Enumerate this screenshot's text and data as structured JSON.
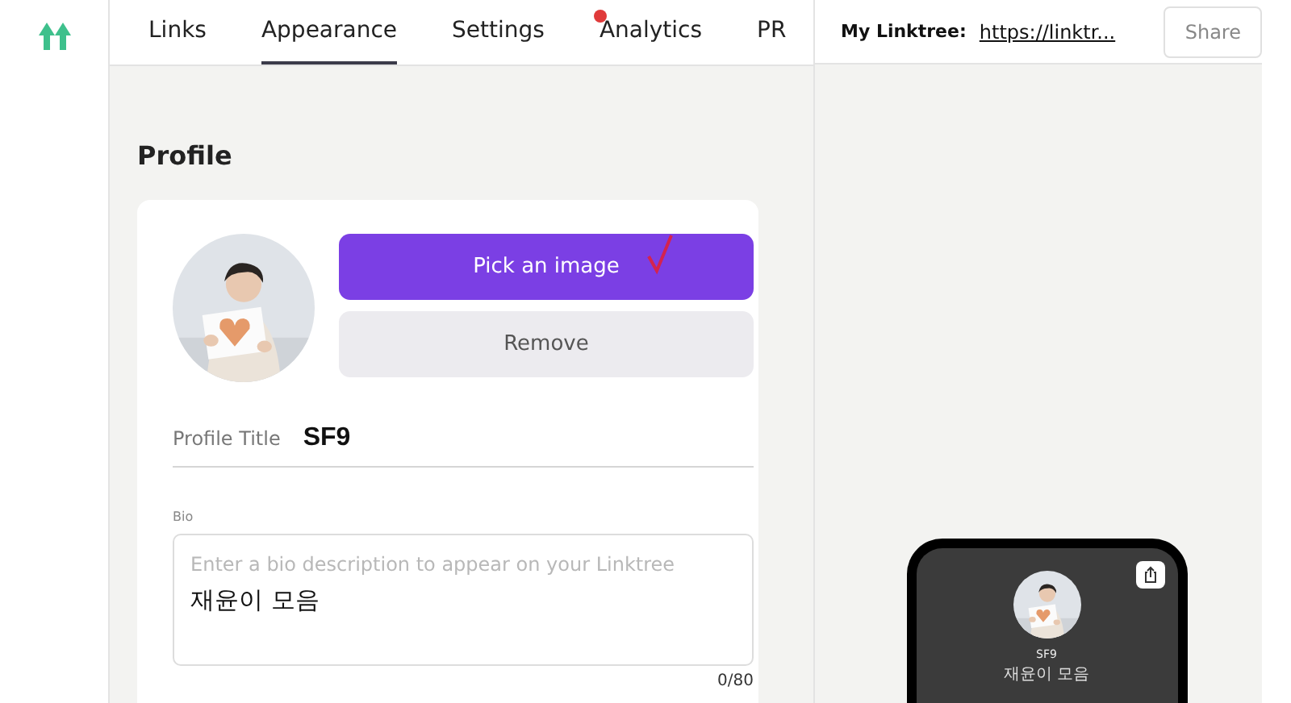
{
  "tabs": [
    {
      "label": "Links",
      "selected": false,
      "dot": false
    },
    {
      "label": "Appearance",
      "selected": true,
      "dot": false
    },
    {
      "label": "Settings",
      "selected": false,
      "dot": false
    },
    {
      "label": "Analytics",
      "selected": false,
      "dot": true
    },
    {
      "label": "PR",
      "selected": false,
      "dot": false
    }
  ],
  "linktree": {
    "label": "My Linktree:",
    "url": "https://linktr...",
    "share": "Share"
  },
  "section_title": "Profile",
  "profile": {
    "pick_button": "Pick an image",
    "remove_button": "Remove",
    "title_label": "Profile Title",
    "title_value": "SF9",
    "bio_label": "Bio",
    "bio_placeholder": "Enter a bio description to appear on your Linktree",
    "bio_value": "재윤이 모음",
    "bio_count": "0/80"
  },
  "preview": {
    "title": "SF9",
    "bio": "재윤이 모음"
  }
}
